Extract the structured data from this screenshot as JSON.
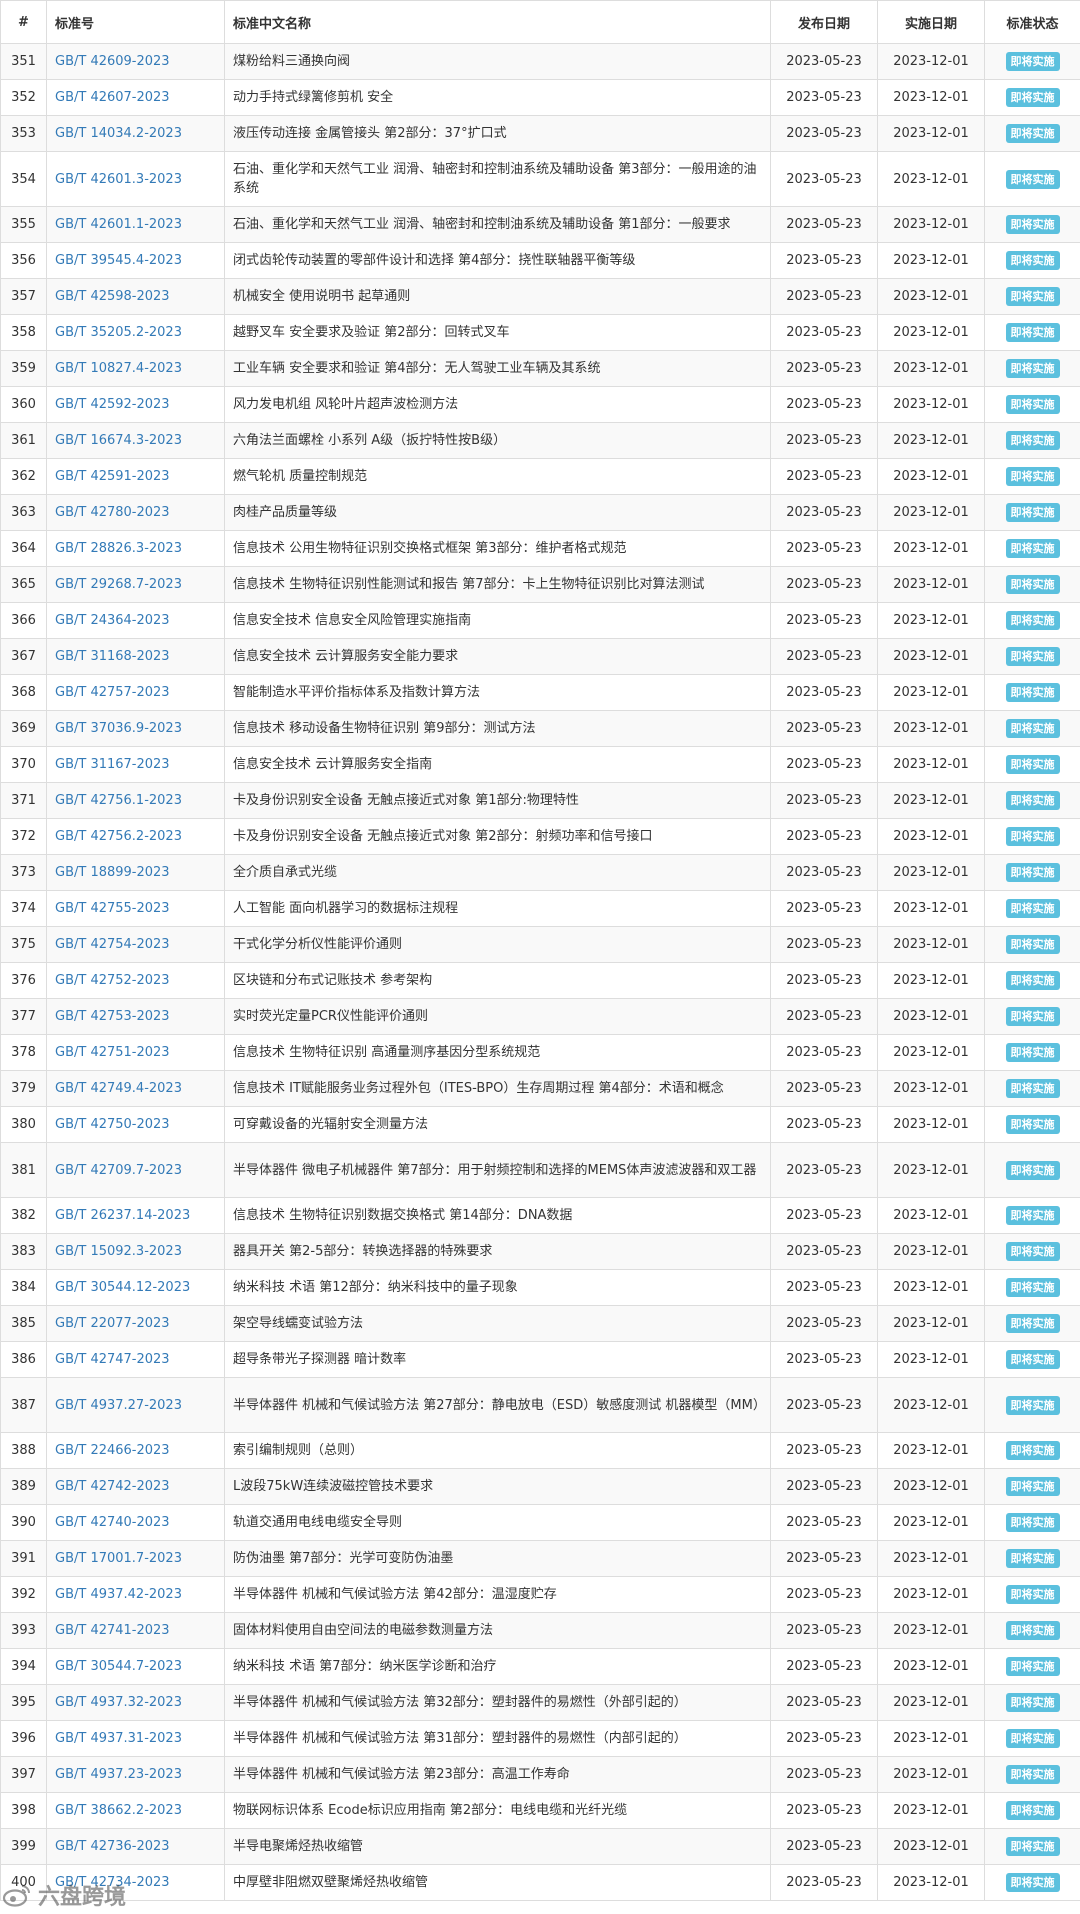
{
  "table": {
    "headers": [
      "#",
      "标准号",
      "标准中文名称",
      "发布日期",
      "实施日期",
      "标准状态"
    ],
    "rows": [
      {
        "num": "351",
        "code": "GB/T 42609-2023",
        "name": "煤粉给料三通换向阀",
        "pub": "2023-05-23",
        "impl": "2023-12-01",
        "status": "即将实施"
      },
      {
        "num": "352",
        "code": "GB/T 42607-2023",
        "name": "动力手持式绿篱修剪机 安全",
        "pub": "2023-05-23",
        "impl": "2023-12-01",
        "status": "即将实施"
      },
      {
        "num": "353",
        "code": "GB/T 14034.2-2023",
        "name": "液压传动连接 金属管接头 第2部分：37°扩口式",
        "pub": "2023-05-23",
        "impl": "2023-12-01",
        "status": "即将实施"
      },
      {
        "num": "354",
        "code": "GB/T 42601.3-2023",
        "name": "石油、重化学和天然气工业 润滑、轴密封和控制油系统及辅助设备 第3部分：一般用途的油系统",
        "pub": "2023-05-23",
        "impl": "2023-12-01",
        "status": "即将实施"
      },
      {
        "num": "355",
        "code": "GB/T 42601.1-2023",
        "name": "石油、重化学和天然气工业 润滑、轴密封和控制油系统及辅助设备 第1部分：一般要求",
        "pub": "2023-05-23",
        "impl": "2023-12-01",
        "status": "即将实施"
      },
      {
        "num": "356",
        "code": "GB/T 39545.4-2023",
        "name": "闭式齿轮传动装置的零部件设计和选择 第4部分：挠性联轴器平衡等级",
        "pub": "2023-05-23",
        "impl": "2023-12-01",
        "status": "即将实施"
      },
      {
        "num": "357",
        "code": "GB/T 42598-2023",
        "name": "机械安全 使用说明书 起草通则",
        "pub": "2023-05-23",
        "impl": "2023-12-01",
        "status": "即将实施"
      },
      {
        "num": "358",
        "code": "GB/T 35205.2-2023",
        "name": "越野叉车 安全要求及验证 第2部分：回转式叉车",
        "pub": "2023-05-23",
        "impl": "2023-12-01",
        "status": "即将实施"
      },
      {
        "num": "359",
        "code": "GB/T 10827.4-2023",
        "name": "工业车辆 安全要求和验证 第4部分：无人驾驶工业车辆及其系统",
        "pub": "2023-05-23",
        "impl": "2023-12-01",
        "status": "即将实施"
      },
      {
        "num": "360",
        "code": "GB/T 42592-2023",
        "name": "风力发电机组 风轮叶片超声波检测方法",
        "pub": "2023-05-23",
        "impl": "2023-12-01",
        "status": "即将实施"
      },
      {
        "num": "361",
        "code": "GB/T 16674.3-2023",
        "name": "六角法兰面螺栓 小系列 A级（扳拧特性按B级）",
        "pub": "2023-05-23",
        "impl": "2023-12-01",
        "status": "即将实施"
      },
      {
        "num": "362",
        "code": "GB/T 42591-2023",
        "name": "燃气轮机 质量控制规范",
        "pub": "2023-05-23",
        "impl": "2023-12-01",
        "status": "即将实施"
      },
      {
        "num": "363",
        "code": "GB/T 42780-2023",
        "name": "肉桂产品质量等级",
        "pub": "2023-05-23",
        "impl": "2023-12-01",
        "status": "即将实施"
      },
      {
        "num": "364",
        "code": "GB/T 28826.3-2023",
        "name": "信息技术 公用生物特征识别交换格式框架 第3部分：维护者格式规范",
        "pub": "2023-05-23",
        "impl": "2023-12-01",
        "status": "即将实施"
      },
      {
        "num": "365",
        "code": "GB/T 29268.7-2023",
        "name": "信息技术 生物特征识别性能测试和报告 第7部分：卡上生物特征识别比对算法测试",
        "pub": "2023-05-23",
        "impl": "2023-12-01",
        "status": "即将实施"
      },
      {
        "num": "366",
        "code": "GB/T 24364-2023",
        "name": "信息安全技术 信息安全风险管理实施指南",
        "pub": "2023-05-23",
        "impl": "2023-12-01",
        "status": "即将实施"
      },
      {
        "num": "367",
        "code": "GB/T 31168-2023",
        "name": "信息安全技术 云计算服务安全能力要求",
        "pub": "2023-05-23",
        "impl": "2023-12-01",
        "status": "即将实施"
      },
      {
        "num": "368",
        "code": "GB/T 42757-2023",
        "name": "智能制造水平评价指标体系及指数计算方法",
        "pub": "2023-05-23",
        "impl": "2023-12-01",
        "status": "即将实施"
      },
      {
        "num": "369",
        "code": "GB/T 37036.9-2023",
        "name": "信息技术 移动设备生物特征识别 第9部分：测试方法",
        "pub": "2023-05-23",
        "impl": "2023-12-01",
        "status": "即将实施"
      },
      {
        "num": "370",
        "code": "GB/T 31167-2023",
        "name": "信息安全技术 云计算服务安全指南",
        "pub": "2023-05-23",
        "impl": "2023-12-01",
        "status": "即将实施"
      },
      {
        "num": "371",
        "code": "GB/T 42756.1-2023",
        "name": "卡及身份识别安全设备 无触点接近式对象 第1部分:物理特性",
        "pub": "2023-05-23",
        "impl": "2023-12-01",
        "status": "即将实施"
      },
      {
        "num": "372",
        "code": "GB/T 42756.2-2023",
        "name": "卡及身份识别安全设备 无触点接近式对象 第2部分：射频功率和信号接口",
        "pub": "2023-05-23",
        "impl": "2023-12-01",
        "status": "即将实施"
      },
      {
        "num": "373",
        "code": "GB/T 18899-2023",
        "name": "全介质自承式光缆",
        "pub": "2023-05-23",
        "impl": "2023-12-01",
        "status": "即将实施"
      },
      {
        "num": "374",
        "code": "GB/T 42755-2023",
        "name": "人工智能 面向机器学习的数据标注规程",
        "pub": "2023-05-23",
        "impl": "2023-12-01",
        "status": "即将实施"
      },
      {
        "num": "375",
        "code": "GB/T 42754-2023",
        "name": "干式化学分析仪性能评价通则",
        "pub": "2023-05-23",
        "impl": "2023-12-01",
        "status": "即将实施"
      },
      {
        "num": "376",
        "code": "GB/T 42752-2023",
        "name": "区块链和分布式记账技术 参考架构",
        "pub": "2023-05-23",
        "impl": "2023-12-01",
        "status": "即将实施"
      },
      {
        "num": "377",
        "code": "GB/T 42753-2023",
        "name": "实时荧光定量PCR仪性能评价通则",
        "pub": "2023-05-23",
        "impl": "2023-12-01",
        "status": "即将实施"
      },
      {
        "num": "378",
        "code": "GB/T 42751-2023",
        "name": "信息技术 生物特征识别 高通量测序基因分型系统规范",
        "pub": "2023-05-23",
        "impl": "2023-12-01",
        "status": "即将实施"
      },
      {
        "num": "379",
        "code": "GB/T 42749.4-2023",
        "name": "信息技术 IT赋能服务业务过程外包（ITES-BPO）生存周期过程 第4部分：术语和概念",
        "pub": "2023-05-23",
        "impl": "2023-12-01",
        "status": "即将实施"
      },
      {
        "num": "380",
        "code": "GB/T 42750-2023",
        "name": "可穿戴设备的光辐射安全测量方法",
        "pub": "2023-05-23",
        "impl": "2023-12-01",
        "status": "即将实施"
      },
      {
        "num": "381",
        "code": "GB/T 42709.7-2023",
        "name": "半导体器件 微电子机械器件 第7部分：用于射频控制和选择的MEMS体声波滤波器和双工器",
        "pub": "2023-05-23",
        "impl": "2023-12-01",
        "status": "即将实施"
      },
      {
        "num": "382",
        "code": "GB/T 26237.14-2023",
        "name": "信息技术 生物特征识别数据交换格式 第14部分：DNA数据",
        "pub": "2023-05-23",
        "impl": "2023-12-01",
        "status": "即将实施"
      },
      {
        "num": "383",
        "code": "GB/T 15092.3-2023",
        "name": "器具开关 第2-5部分：转换选择器的特殊要求",
        "pub": "2023-05-23",
        "impl": "2023-12-01",
        "status": "即将实施"
      },
      {
        "num": "384",
        "code": "GB/T 30544.12-2023",
        "name": "纳米科技 术语 第12部分：纳米科技中的量子现象",
        "pub": "2023-05-23",
        "impl": "2023-12-01",
        "status": "即将实施"
      },
      {
        "num": "385",
        "code": "GB/T 22077-2023",
        "name": "架空导线蠕变试验方法",
        "pub": "2023-05-23",
        "impl": "2023-12-01",
        "status": "即将实施"
      },
      {
        "num": "386",
        "code": "GB/T 42747-2023",
        "name": "超导条带光子探测器 暗计数率",
        "pub": "2023-05-23",
        "impl": "2023-12-01",
        "status": "即将实施"
      },
      {
        "num": "387",
        "code": "GB/T 4937.27-2023",
        "name": "半导体器件 机械和气候试验方法 第27部分：静电放电（ESD）敏感度测试 机器模型（MM）",
        "pub": "2023-05-23",
        "impl": "2023-12-01",
        "status": "即将实施"
      },
      {
        "num": "388",
        "code": "GB/T 22466-2023",
        "name": "索引编制规则（总则）",
        "pub": "2023-05-23",
        "impl": "2023-12-01",
        "status": "即将实施"
      },
      {
        "num": "389",
        "code": "GB/T 42742-2023",
        "name": "L波段75kW连续波磁控管技术要求",
        "pub": "2023-05-23",
        "impl": "2023-12-01",
        "status": "即将实施"
      },
      {
        "num": "390",
        "code": "GB/T 42740-2023",
        "name": "轨道交通用电线电缆安全导则",
        "pub": "2023-05-23",
        "impl": "2023-12-01",
        "status": "即将实施"
      },
      {
        "num": "391",
        "code": "GB/T 17001.7-2023",
        "name": "防伪油墨 第7部分：光学可变防伪油墨",
        "pub": "2023-05-23",
        "impl": "2023-12-01",
        "status": "即将实施"
      },
      {
        "num": "392",
        "code": "GB/T 4937.42-2023",
        "name": "半导体器件 机械和气候试验方法 第42部分：温湿度贮存",
        "pub": "2023-05-23",
        "impl": "2023-12-01",
        "status": "即将实施"
      },
      {
        "num": "393",
        "code": "GB/T 42741-2023",
        "name": "固体材料使用自由空间法的电磁参数测量方法",
        "pub": "2023-05-23",
        "impl": "2023-12-01",
        "status": "即将实施"
      },
      {
        "num": "394",
        "code": "GB/T 30544.7-2023",
        "name": "纳米科技 术语 第7部分：纳米医学诊断和治疗",
        "pub": "2023-05-23",
        "impl": "2023-12-01",
        "status": "即将实施"
      },
      {
        "num": "395",
        "code": "GB/T 4937.32-2023",
        "name": "半导体器件 机械和气候试验方法 第32部分：塑封器件的易燃性（外部引起的）",
        "pub": "2023-05-23",
        "impl": "2023-12-01",
        "status": "即将实施"
      },
      {
        "num": "396",
        "code": "GB/T 4937.31-2023",
        "name": "半导体器件 机械和气候试验方法 第31部分：塑封器件的易燃性（内部引起的）",
        "pub": "2023-05-23",
        "impl": "2023-12-01",
        "status": "即将实施"
      },
      {
        "num": "397",
        "code": "GB/T 4937.23-2023",
        "name": "半导体器件 机械和气候试验方法 第23部分：高温工作寿命",
        "pub": "2023-05-23",
        "impl": "2023-12-01",
        "status": "即将实施"
      },
      {
        "num": "398",
        "code": "GB/T 38662.2-2023",
        "name": "物联网标识体系 Ecode标识应用指南 第2部分：电线电缆和光纤光缆",
        "pub": "2023-05-23",
        "impl": "2023-12-01",
        "status": "即将实施"
      },
      {
        "num": "399",
        "code": "GB/T 42736-2023",
        "name": "半导电聚烯烃热收缩管",
        "pub": "2023-05-23",
        "impl": "2023-12-01",
        "status": "即将实施"
      },
      {
        "num": "400",
        "code": "GB/T 42734-2023",
        "name": "中厚壁非阻燃双壁聚烯烃热收缩管",
        "pub": "2023-05-23",
        "impl": "2023-12-01",
        "status": "即将实施"
      }
    ]
  },
  "watermark": {
    "text": "六盘跨境",
    "icon": "weibo-logo-icon"
  }
}
